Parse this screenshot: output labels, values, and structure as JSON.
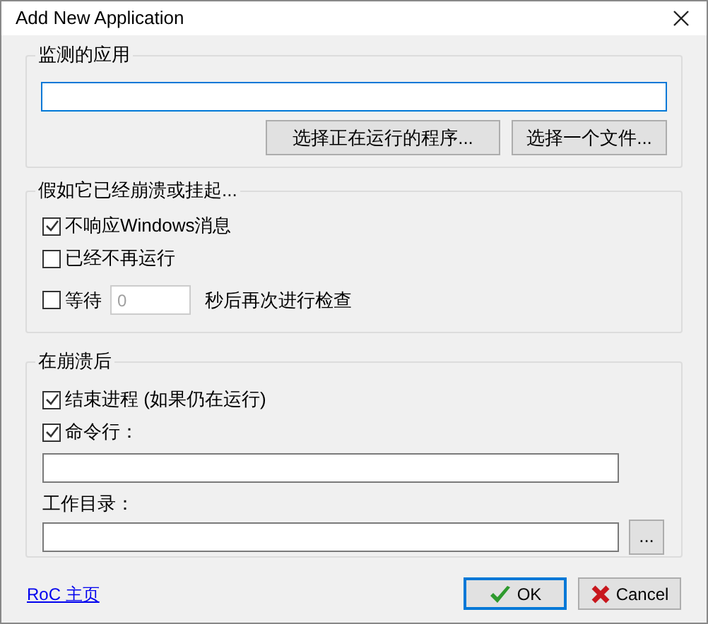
{
  "window": {
    "title": "Add New Application"
  },
  "monitored": {
    "title": "监测的应用",
    "path_field": {
      "focused": true
    },
    "buttons": [
      "选择正在运行的程序...",
      "选择一个文件..."
    ]
  },
  "hang": {
    "title": "假如它已经崩溃或挂起...",
    "options": [
      {
        "kind": "checkbox",
        "label": "不响应Windows消息",
        "checked": true
      },
      {
        "kind": "checkbox",
        "label": "已经不再运行",
        "checked": false
      },
      {
        "kind": "wait",
        "label": "等待",
        "checked": false,
        "value": "0",
        "disabled": true,
        "suffix": "秒后再次进行检查"
      }
    ]
  },
  "after": {
    "title": "在崩溃后",
    "kill": {
      "label": "结束进程 (如果仍在运行)",
      "checked": true
    },
    "command": {
      "label": "命令行：",
      "checked": true
    },
    "workdir": {
      "label": "工作目录：",
      "browse": "..."
    }
  },
  "footer": {
    "link": "RoC 主页",
    "buttons": [
      {
        "kind": "ok",
        "label": "OK",
        "default": true
      },
      {
        "kind": "cancel",
        "label": "Cancel",
        "default": false
      }
    ]
  }
}
